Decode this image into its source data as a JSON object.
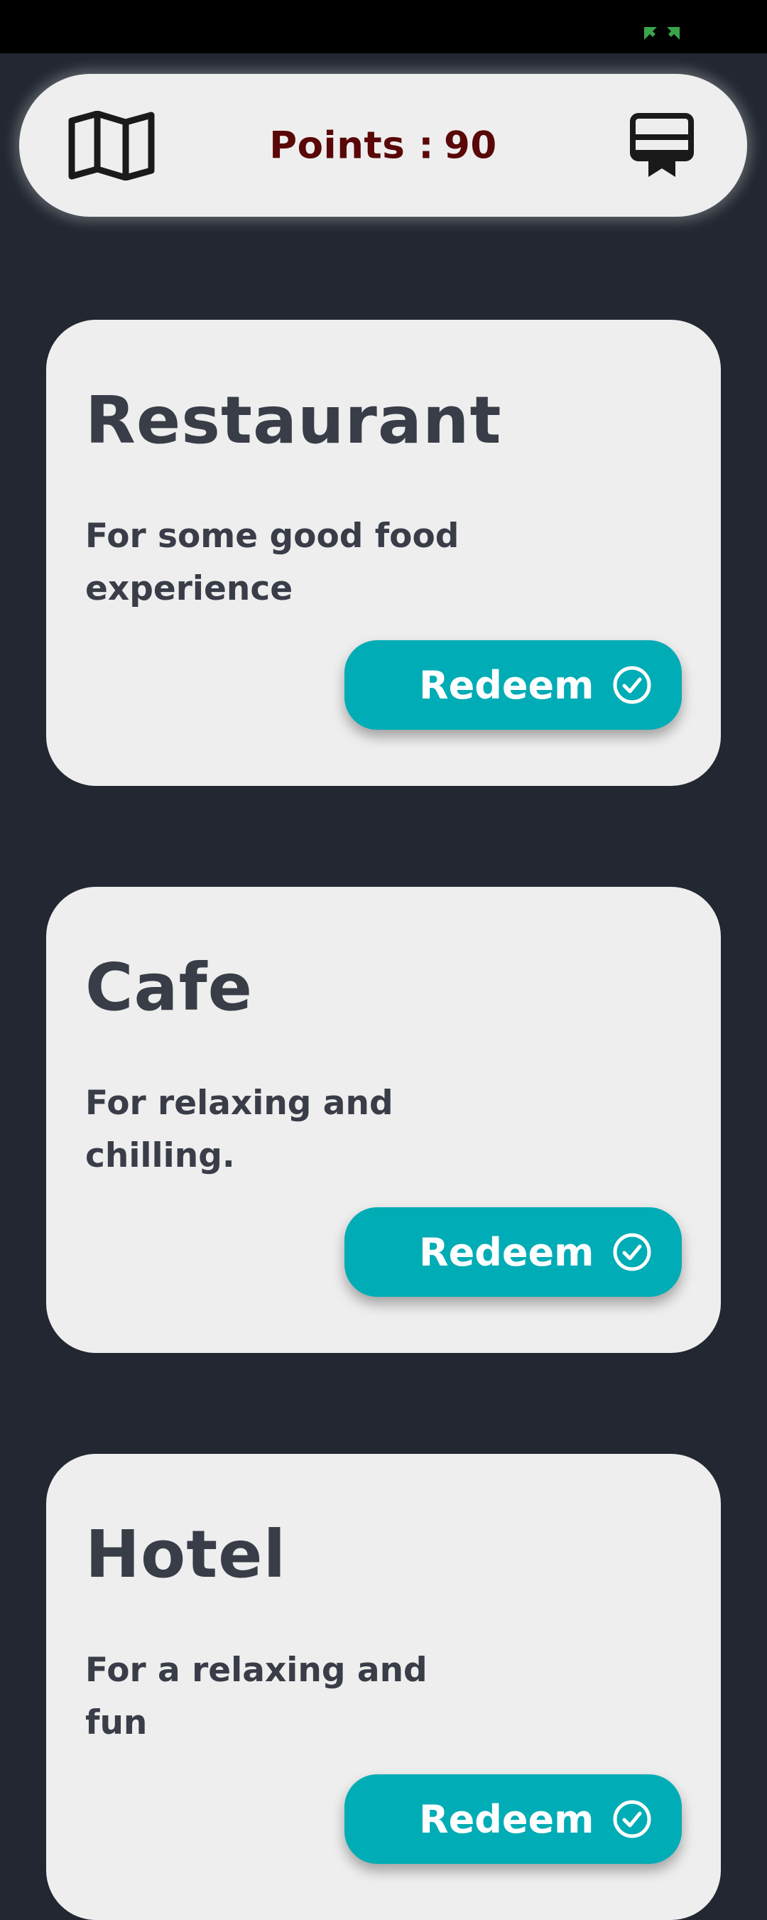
{
  "header": {
    "points_label": "Points :",
    "points_value": "90",
    "left_icon": "map-icon",
    "right_icon": "certificate-icon"
  },
  "cards": [
    {
      "title": "Restaurant",
      "description": "For some good food experience",
      "button_label": "Redeem",
      "button_icon": "check-circle-icon"
    },
    {
      "title": "Cafe",
      "description": "For relaxing and chilling.",
      "button_label": "Redeem",
      "button_icon": "check-circle-icon"
    },
    {
      "title": "Hotel",
      "description": "For a relaxing and fun",
      "button_label": "Redeem",
      "button_icon": "check-circle-icon"
    }
  ],
  "colors": {
    "background": "#222731",
    "surface": "#eeeeee",
    "points_text": "#5a0708",
    "card_text": "#393d48",
    "accent": "#00acb5",
    "status_indicator": "#3aa44a"
  }
}
